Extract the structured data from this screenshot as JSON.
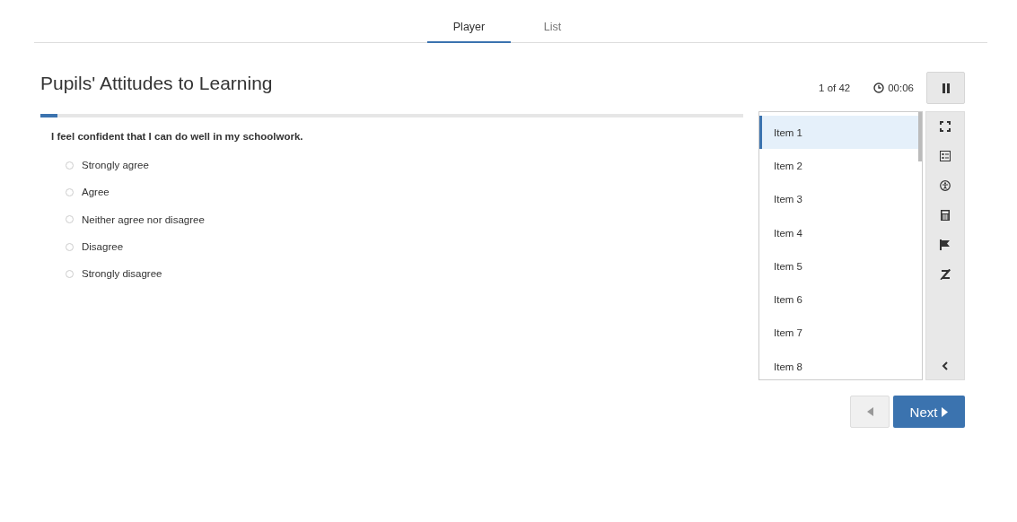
{
  "tabs": [
    {
      "label": "Player",
      "selected": true
    },
    {
      "label": "List",
      "selected": false
    }
  ],
  "title": "Pupils' Attitudes to Learning",
  "counter": "1 of 42",
  "timer": "00:06",
  "progress": {
    "level": 0.024
  },
  "question": "I feel confident that I can do well in my schoolwork.",
  "options": [
    {
      "label": "Strongly agree",
      "selected": false
    },
    {
      "label": "Agree",
      "selected": false
    },
    {
      "label": "Neither agree nor disagree",
      "selected": false
    },
    {
      "label": "Disagree",
      "selected": false
    },
    {
      "label": "Strongly disagree",
      "selected": false
    }
  ],
  "items": [
    {
      "label": "Item 1",
      "selected": true
    },
    {
      "label": "Item 2",
      "selected": false
    },
    {
      "label": "Item 3",
      "selected": false
    },
    {
      "label": "Item 4",
      "selected": false
    },
    {
      "label": "Item 5",
      "selected": false
    },
    {
      "label": "Item 6",
      "selected": false
    },
    {
      "label": "Item 7",
      "selected": false
    },
    {
      "label": "Item 8",
      "selected": false
    }
  ],
  "nav": {
    "previous": {
      "disabled": true
    },
    "next": {
      "label": "Next",
      "disabled": false
    }
  }
}
